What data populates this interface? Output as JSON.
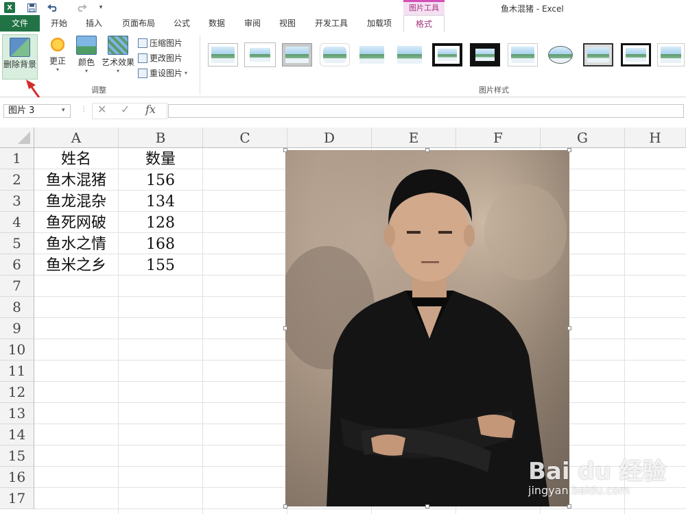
{
  "window": {
    "title": "鱼木混猪 - Excel"
  },
  "quick_access": {
    "app_icon": "X",
    "save_icon": "save-icon",
    "undo_icon": "undo-icon",
    "redo_icon": "redo-icon",
    "customize_icon": "customize-icon"
  },
  "context_tab_header": "图片工具",
  "tabs": [
    "文件",
    "开始",
    "插入",
    "页面布局",
    "公式",
    "数据",
    "审阅",
    "视图",
    "开发工具",
    "加载项",
    "格式"
  ],
  "ribbon": {
    "remove_background": "删除背景",
    "corrections": "更正",
    "color": "颜色",
    "artistic_effects": "艺术效果",
    "compress_pictures": "压缩图片",
    "change_picture": "更改图片",
    "reset_picture": "重设图片",
    "adjust_group_label": "调整",
    "picture_styles_label": "图片样式"
  },
  "formula_bar": {
    "name_box": "图片 3",
    "cancel_icon": "cancel-icon",
    "enter_icon": "enter-icon",
    "fx": "fx",
    "formula": ""
  },
  "columns": [
    "A",
    "B",
    "C",
    "D",
    "E",
    "F",
    "G",
    "H"
  ],
  "rows": [
    "1",
    "2",
    "3",
    "4",
    "5",
    "6",
    "7",
    "8",
    "9",
    "10",
    "11",
    "12",
    "13",
    "14",
    "15",
    "16",
    "17"
  ],
  "table": {
    "header": [
      "姓名",
      "数量"
    ],
    "data": [
      [
        "鱼木混猪",
        "156"
      ],
      [
        "鱼龙混杂",
        "134"
      ],
      [
        "鱼死网破",
        "128"
      ],
      [
        "鱼水之情",
        "168"
      ],
      [
        "鱼米之乡",
        "155"
      ]
    ]
  },
  "colors": {
    "excel_green": "#217346",
    "context_magenta": "#a2357e",
    "arrow_red": "#d42a2a"
  },
  "watermark": {
    "brand": "Bai du 经验",
    "url": "jingyan.baidu.com"
  }
}
